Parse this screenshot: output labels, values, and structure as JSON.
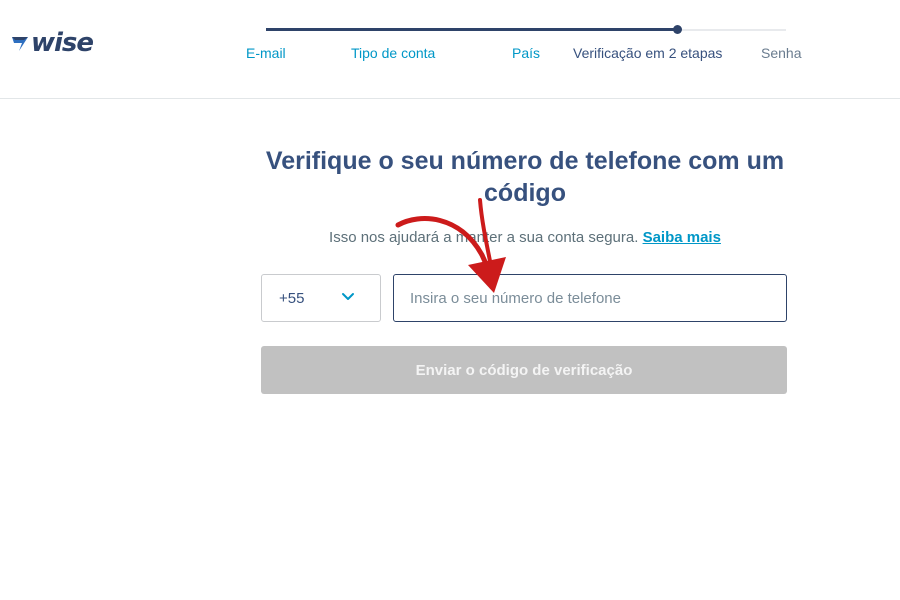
{
  "brand": {
    "name": "wise",
    "accent": "#0097c7",
    "navy": "#2e4369",
    "annotation_color": "#cc1b1b"
  },
  "stepper": {
    "progress": 0.79,
    "steps": [
      {
        "label": "E-mail",
        "state": "done"
      },
      {
        "label": "Tipo de conta",
        "state": "done"
      },
      {
        "label": "País",
        "state": "done"
      },
      {
        "label": "Verificação em 2 etapas",
        "state": "active"
      },
      {
        "label": "Senha",
        "state": "todo"
      }
    ]
  },
  "main": {
    "title": "Verifique o seu número de telefone com um código",
    "subtitle": "Isso nos ajudará a manter a sua conta segura.",
    "learn_more": "Saiba mais",
    "country_code": "+55",
    "country_icon": "chevron-down-icon",
    "phone_placeholder": "Insira o seu número de telefone",
    "phone_value": "",
    "send_button": "Enviar o código de verificação"
  }
}
